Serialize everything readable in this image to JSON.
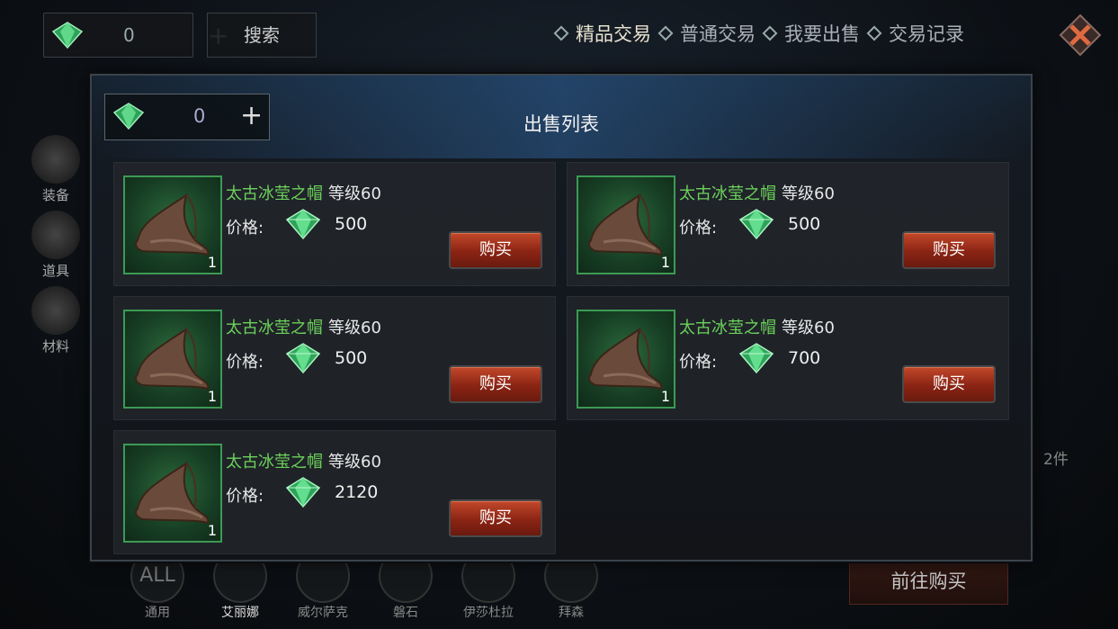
{
  "top": {
    "currency_value": "0",
    "plus": "+",
    "search_label": "搜索",
    "tabs": [
      "精品交易",
      "普通交易",
      "我要出售",
      "交易记录"
    ]
  },
  "side": [
    "装备",
    "道具",
    "材料"
  ],
  "heroes": [
    "通用",
    "艾丽娜",
    "威尔萨克",
    "磐石",
    "伊莎杜拉",
    "拜森"
  ],
  "heroes_all_label": "ALL",
  "goto_label": "前往购买",
  "faint_count": "2件",
  "modal": {
    "title": "出售列表",
    "currency_value": "0",
    "plus": "+",
    "price_label": "价格:",
    "buy_label": "购买",
    "items": [
      {
        "name": "太古冰莹之帽",
        "level": "等级60",
        "price": "500",
        "qty": "1"
      },
      {
        "name": "太古冰莹之帽",
        "level": "等级60",
        "price": "500",
        "qty": "1"
      },
      {
        "name": "太古冰莹之帽",
        "level": "等级60",
        "price": "500",
        "qty": "1"
      },
      {
        "name": "太古冰莹之帽",
        "level": "等级60",
        "price": "700",
        "qty": "1"
      },
      {
        "name": "太古冰莹之帽",
        "level": "等级60",
        "price": "2120",
        "qty": "1"
      }
    ]
  },
  "colors": {
    "item_name": "#6cd15c",
    "buy_button": "#a8321c",
    "gem": "#3fbf6a"
  }
}
